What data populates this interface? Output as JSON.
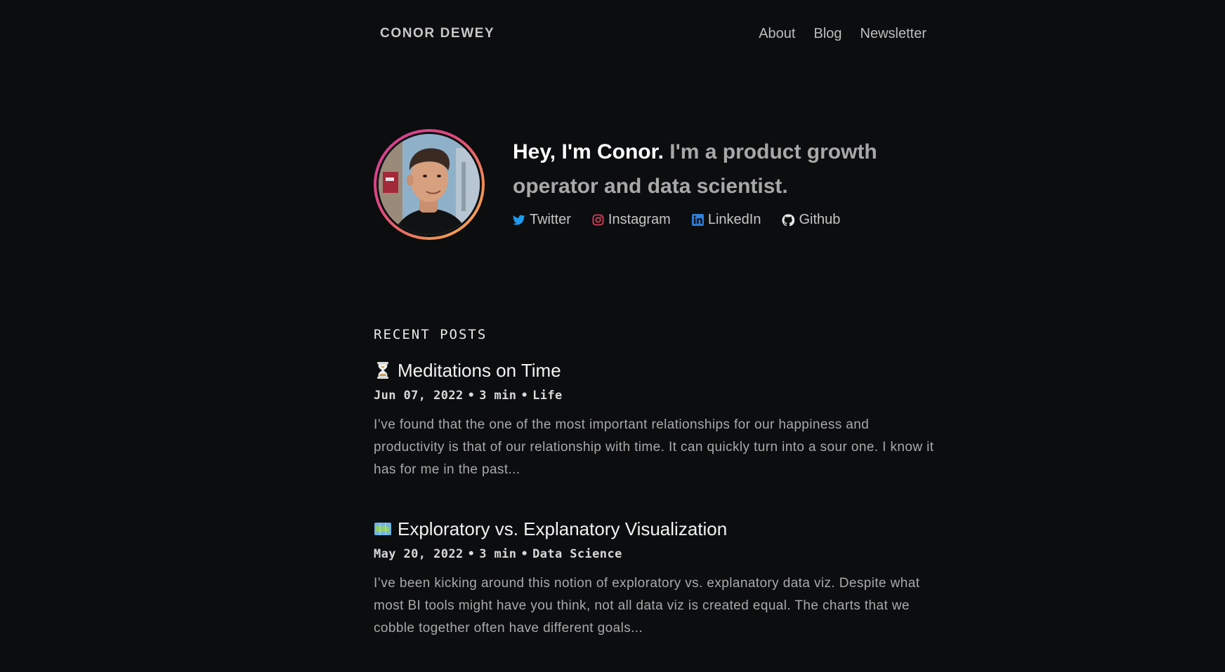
{
  "header": {
    "brand": "CONOR DEWEY",
    "nav": [
      {
        "label": "About"
      },
      {
        "label": "Blog"
      },
      {
        "label": "Newsletter"
      }
    ]
  },
  "hero": {
    "greeting": "Hey, I'm Conor.",
    "tagline": "I'm a product growth operator and data scientist.",
    "socials": [
      {
        "label": "Twitter",
        "icon": "twitter-icon",
        "color": "#1d9bf0"
      },
      {
        "label": "Instagram",
        "icon": "instagram-icon",
        "color": "#e4405f"
      },
      {
        "label": "LinkedIn",
        "icon": "linkedin-icon",
        "color": "#2f7ed8"
      },
      {
        "label": "Github",
        "icon": "github-icon",
        "color": "#e6e6e6"
      }
    ]
  },
  "recent_posts": {
    "title": "RECENT POSTS",
    "posts": [
      {
        "emoji": "hourglass-icon",
        "title": "Meditations on Time",
        "date": "Jun 07, 2022",
        "read_time": "3 min",
        "category": "Life",
        "excerpt": "I’ve found that the one of the most important relationships for our happiness and productivity is that of our relationship with time. It can quickly turn into a sour one. I know it has for me in the past..."
      },
      {
        "emoji": "map-icon",
        "title": "Exploratory vs. Explanatory Visualization",
        "date": "May 20, 2022",
        "read_time": "3 min",
        "category": "Data Science",
        "excerpt": "I’ve been kicking around this notion of exploratory vs. explanatory data viz. Despite what most BI tools might have you think, not all data viz is created equal. The charts that we cobble together often have different goals..."
      }
    ]
  },
  "colors": {
    "background": "#0b0d0f",
    "avatar_ring_start": "#d13b9b",
    "avatar_ring_end": "#f6b561"
  }
}
